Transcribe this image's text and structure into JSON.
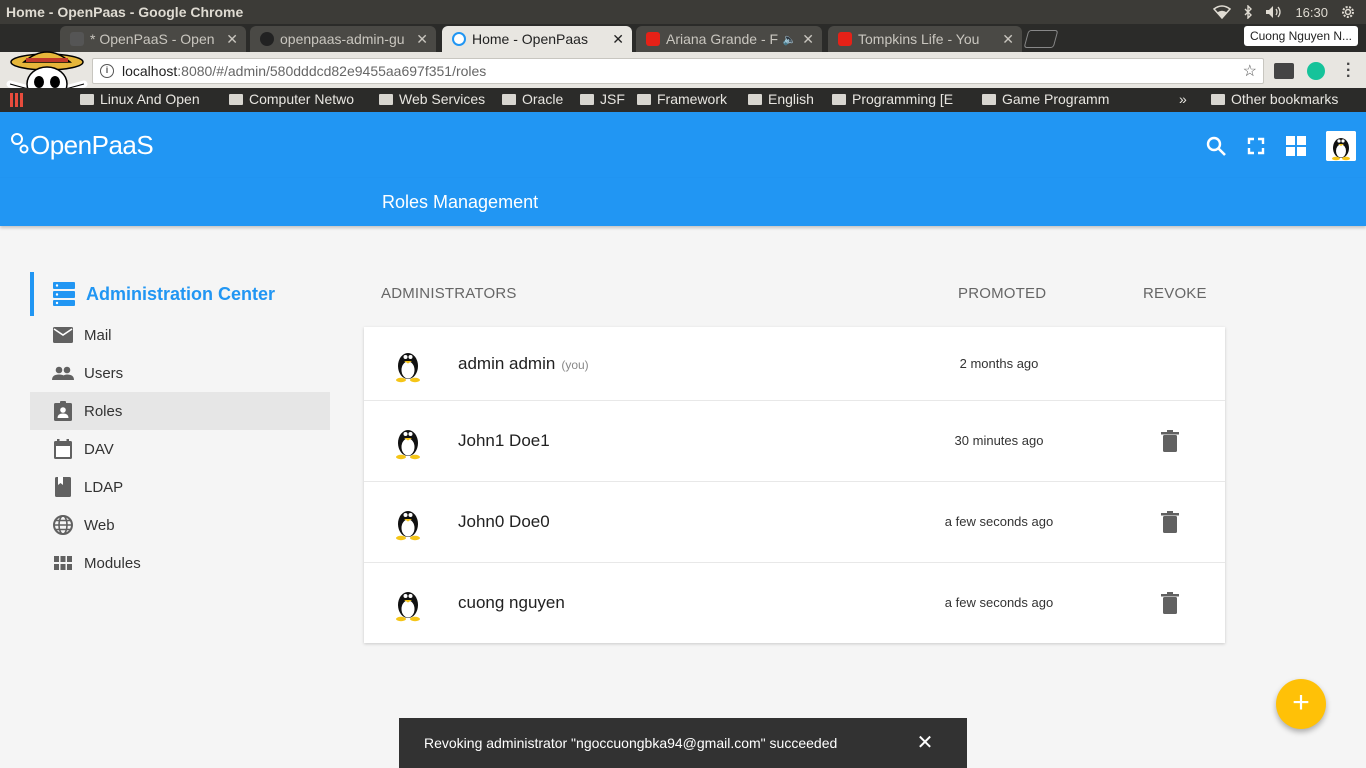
{
  "os": {
    "window_title": "Home - OpenPaas - Google Chrome",
    "time": "16:30"
  },
  "browser": {
    "tabs": [
      {
        "title": "* OpenPaaS - Open",
        "favicon": "openpaas-icon"
      },
      {
        "title": "openpaas-admin-gu",
        "favicon": "github-icon"
      },
      {
        "title": "Home - OpenPaas",
        "favicon": "openpaas-icon",
        "active": true
      },
      {
        "title": "Ariana Grande - F",
        "favicon": "youtube-icon"
      },
      {
        "title": "Tompkins Life - You",
        "favicon": "youtube-icon"
      }
    ],
    "profile_name": "Cuong Nguyen N...",
    "url_host": "localhost",
    "url_path": ":8080/#/admin/580dddcd82e9455aa697f351/roles",
    "bookmarks": [
      "Linux And Open",
      "Computer Netwo",
      "Web Services",
      "Oracle",
      "JSF",
      "Framework",
      "English",
      "Programming [E",
      "Game Programm"
    ],
    "bookmarks_overflow": "»",
    "other_bookmarks": "Other bookmarks"
  },
  "app": {
    "logo_text": "OpenPaaS",
    "page_title": "Roles Management",
    "accent_color": "#2196f3",
    "fab_color": "#ffc107"
  },
  "sidebar": {
    "title": "Administration Center",
    "items": [
      {
        "label": "Mail",
        "icon": "mail-icon"
      },
      {
        "label": "Users",
        "icon": "users-icon"
      },
      {
        "label": "Roles",
        "icon": "roles-icon",
        "active": true
      },
      {
        "label": "DAV",
        "icon": "calendar-icon"
      },
      {
        "label": "LDAP",
        "icon": "book-icon"
      },
      {
        "label": "Web",
        "icon": "globe-icon"
      },
      {
        "label": "Modules",
        "icon": "modules-icon"
      }
    ]
  },
  "table": {
    "headers": {
      "administrators": "ADMINISTRATORS",
      "promoted": "PROMOTED",
      "revoke": "REVOKE"
    },
    "rows": [
      {
        "name": "admin admin",
        "you_label": "(you)",
        "promoted": "2 months ago",
        "revocable": false
      },
      {
        "name": "John1 Doe1",
        "you_label": "",
        "promoted": "30 minutes ago",
        "revocable": true
      },
      {
        "name": "John0 Doe0",
        "you_label": "",
        "promoted": "a few seconds ago",
        "revocable": true
      },
      {
        "name": "cuong nguyen",
        "you_label": "",
        "promoted": "a few seconds ago",
        "revocable": true
      }
    ]
  },
  "fab": {
    "label": "+"
  },
  "snackbar": {
    "message": "Revoking administrator \"ngoccuongbka94@gmail.com\" succeeded",
    "close_label": "✕"
  }
}
